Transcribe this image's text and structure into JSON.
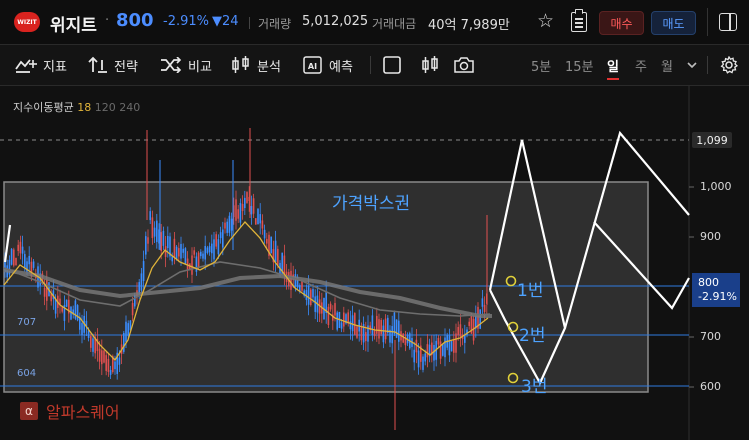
{
  "header": {
    "logo_text": "WIZIT",
    "stock_name": "위지트",
    "separator": "·",
    "price": "800",
    "change_pct": "-2.91%",
    "change_amt": "▼24",
    "volume_label": "거래량",
    "volume_value": "5,012,025",
    "amount_label": "거래대금",
    "amount_value": "40억 7,989만",
    "buy_label": "매수",
    "sell_label": "매도",
    "buy_color": "#ff5a5a",
    "sell_color": "#5b9cff"
  },
  "toolbar": {
    "indicator_label": "지표",
    "strategy_label": "전략",
    "compare_label": "비교",
    "analysis_label": "분석",
    "predict_label": "예측",
    "periods": [
      "5분",
      "15분",
      "일",
      "주",
      "월"
    ],
    "active_period": "일"
  },
  "chart": {
    "ma_label": "지수이동평균",
    "ma_periods": [
      "18",
      "120",
      "240"
    ],
    "y_axis_labels": [
      "1,099",
      "1,000",
      "900",
      "800",
      "700",
      "600"
    ],
    "current_price": "800",
    "current_pct": "-2.91%",
    "level_labels": [
      "707",
      "604"
    ],
    "box_title": "가격박스권",
    "annotations": [
      "1번",
      "2번",
      "3번"
    ],
    "watermark_icon": "α",
    "watermark_text": "알파스퀘어",
    "up_color": "#e05050",
    "down_color": "#3a8dff",
    "ma18_color": "#e0b43a"
  },
  "chart_data": {
    "type": "candlestick",
    "y_axis_ticks": [
      600,
      700,
      800,
      900,
      1000,
      1099
    ],
    "current_price": 800,
    "box_range": [
      600,
      1000
    ],
    "levels": [
      707,
      604
    ],
    "annotated_targets": [
      {
        "label": "1번",
        "price": 790
      },
      {
        "label": "2번",
        "price": 722
      },
      {
        "label": "3번",
        "price": 615
      }
    ],
    "moving_averages": [
      18,
      120,
      240
    ]
  }
}
